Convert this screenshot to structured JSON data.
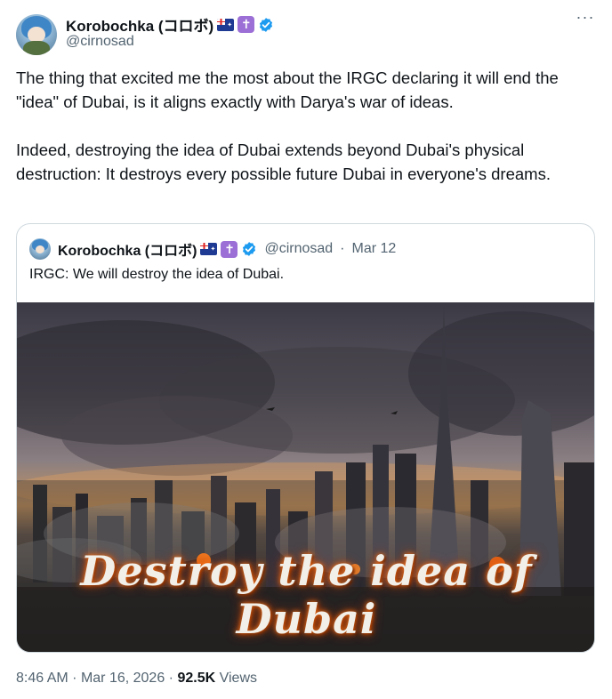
{
  "tweet": {
    "author_name": "Korobochka (コロボ)",
    "author_handle": "@cirnosad",
    "paragraphs": [
      "The thing that excited me the most about the IRGC declaring it will end the \"idea\" of Dubai, is it aligns exactly with Darya's war of ideas.",
      "Indeed, destroying the idea of Dubai extends beyond Dubai's physical destruction: It destroys every possible future Dubai in everyone's dreams."
    ],
    "more_label": "···"
  },
  "quote": {
    "author_name": "Korobochka (コロボ)",
    "author_handle": "@cirnosad",
    "separator": "·",
    "date": "Mar 12",
    "text": "IRGC: We will destroy the idea of Dubai.",
    "image_caption": "Destroy the idea of Dubai"
  },
  "footer": {
    "time": "8:46 AM",
    "separator": "·",
    "date": "Mar 16, 2026",
    "views_count": "92.5K",
    "views_label": "Views"
  },
  "colors": {
    "text": "#0f1419",
    "muted": "#536471",
    "verified": "#1d9bf0",
    "border": "#cfd9de"
  },
  "icons": {
    "verified": "verified-badge-icon",
    "flag": "australia-flag-icon",
    "cross": "cross-badge-icon",
    "more": "more-icon"
  }
}
